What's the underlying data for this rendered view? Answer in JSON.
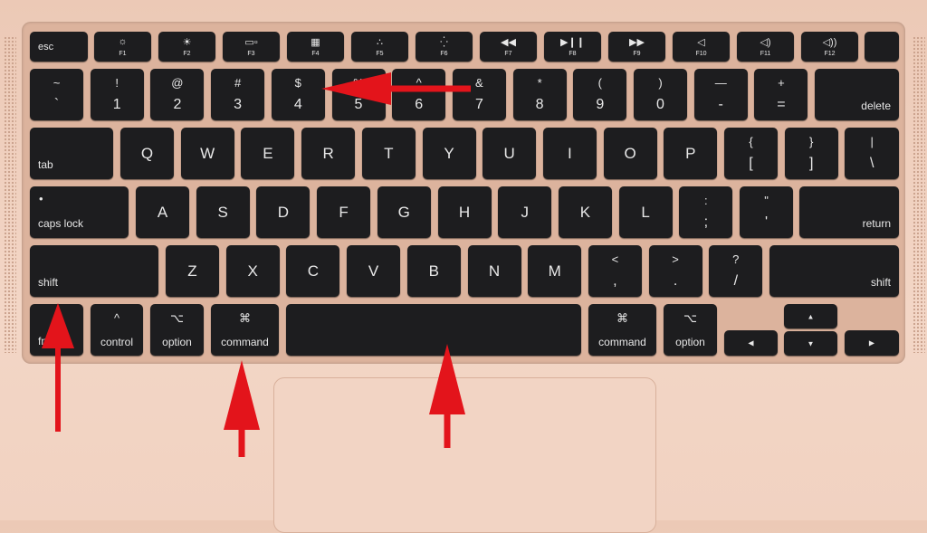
{
  "colors": {
    "key": "#1d1d1f",
    "body": "#f1d2c1",
    "arrow": "#e3141b"
  },
  "function_row": [
    {
      "label": "esc"
    },
    {
      "icon": "brightness-down-icon",
      "glyph": "☼",
      "sub": "F1"
    },
    {
      "icon": "brightness-up-icon",
      "glyph": "☀",
      "sub": "F2"
    },
    {
      "icon": "mission-control-icon",
      "glyph": "▭▫",
      "sub": "F3"
    },
    {
      "icon": "launchpad-icon",
      "glyph": "▦",
      "sub": "F4"
    },
    {
      "icon": "keyboard-backlight-down-icon",
      "glyph": "∴",
      "sub": "F5"
    },
    {
      "icon": "keyboard-backlight-up-icon",
      "glyph": "⁛",
      "sub": "F6"
    },
    {
      "icon": "rewind-icon",
      "glyph": "◀◀",
      "sub": "F7"
    },
    {
      "icon": "play-pause-icon",
      "glyph": "▶❙❙",
      "sub": "F8"
    },
    {
      "icon": "fast-forward-icon",
      "glyph": "▶▶",
      "sub": "F9"
    },
    {
      "icon": "mute-icon",
      "glyph": "◁",
      "sub": "F10"
    },
    {
      "icon": "volume-down-icon",
      "glyph": "◁)",
      "sub": "F11"
    },
    {
      "icon": "volume-up-icon",
      "glyph": "◁))",
      "sub": "F12"
    },
    {
      "icon": "touch-id-icon",
      "glyph": ""
    }
  ],
  "number_row": [
    [
      "~",
      "`"
    ],
    [
      "!",
      "1"
    ],
    [
      "@",
      "2"
    ],
    [
      "#",
      "3"
    ],
    [
      "$",
      "4"
    ],
    [
      "%",
      "5"
    ],
    [
      "^",
      "6"
    ],
    [
      "&",
      "7"
    ],
    [
      "*",
      "8"
    ],
    [
      "(",
      "9"
    ],
    [
      ")",
      "0"
    ],
    [
      "—",
      "-"
    ],
    [
      "+",
      "="
    ]
  ],
  "delete": "delete",
  "tab": "tab",
  "qwerty_row": [
    "Q",
    "W",
    "E",
    "R",
    "T",
    "Y",
    "U",
    "I",
    "O",
    "P"
  ],
  "qwerty_pairs": [
    [
      "{",
      "["
    ],
    [
      "}",
      "]"
    ],
    [
      "|",
      "\\"
    ]
  ],
  "caps_lock": "caps lock",
  "caps_dot": "•",
  "home_row": [
    "A",
    "S",
    "D",
    "F",
    "G",
    "H",
    "J",
    "K",
    "L"
  ],
  "home_pairs": [
    [
      ":",
      ";"
    ],
    [
      "\"",
      "'"
    ]
  ],
  "return": "return",
  "shift": "shift",
  "bottom_letters": [
    "Z",
    "X",
    "C",
    "V",
    "B",
    "N",
    "M"
  ],
  "bottom_pairs": [
    [
      "<",
      ","
    ],
    [
      ">",
      "."
    ],
    [
      "?",
      "/"
    ]
  ],
  "modifiers": {
    "fn": "fn",
    "control": "control",
    "control_glyph": "^",
    "option": "option",
    "option_glyph": "⌥",
    "command": "command",
    "command_glyph": "⌘"
  },
  "arrow_keys": {
    "up": "▲",
    "down": "▼",
    "left": "◀",
    "right": "▶"
  }
}
